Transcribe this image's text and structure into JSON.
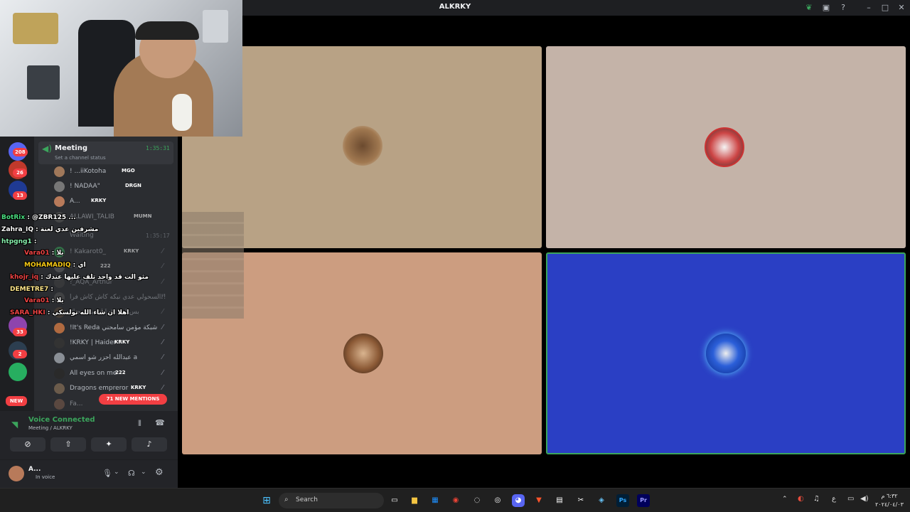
{
  "window": {
    "title": "ALKRKY"
  },
  "titlebar_icons": [
    "leaf-icon",
    "inbox-icon",
    "help-icon",
    "minimize-icon",
    "maximize-icon",
    "close-icon"
  ],
  "stage": {
    "tiles": [
      {
        "name": "tile-participant-1",
        "bg": "#b8a285"
      },
      {
        "name": "tile-participant-2",
        "bg": "#c4b3a8"
      },
      {
        "name": "tile-participant-3",
        "bg": "#cc9d80"
      },
      {
        "name": "tile-participant-4",
        "bg": "#2a3fc4",
        "speaking": true
      }
    ]
  },
  "servers": {
    "badges": [
      "208",
      "26",
      "13",
      "33",
      "2"
    ],
    "new_label": "NEW"
  },
  "channel": {
    "meeting_name": "Meeting",
    "meeting_time": "1:35:31",
    "status_placeholder": "Set a channel status",
    "meeting_users": [
      {
        "name": "! ...iiKotoha",
        "tag": "MGO"
      },
      {
        "name": "! NADAA\"",
        "tag": "DRGN"
      },
      {
        "name": "A...",
        "tag": "KRKY"
      },
      {
        "name": "ALLAWI_TALIB",
        "tag": "MUMN"
      }
    ],
    "waiting_name": "Waiting",
    "waiting_time": "1:35:17",
    "waiting_users": [
      {
        "name": "! Kakarot0_",
        "tag": "KRKY"
      },
      {
        "name": "! ...",
        "tag": "222"
      },
      {
        "name": "!_AQA_Arthur",
        "tag": ""
      },
      {
        "name": "السحولي عدي نبكه كاش كاش فرا!!",
        "tag": ""
      },
      {
        "name": "بس اريد اقرا اشتيه سحنك",
        "tag": ""
      },
      {
        "name": "!It's Reda شبكة مؤمن سامحني",
        "tag": ""
      },
      {
        "name": "!KRKY | Haider",
        "tag": "KRKY"
      },
      {
        "name": "عبدالله احزر شو اسمي a",
        "tag": ""
      },
      {
        "name": "All eyes on me",
        "tag": "222"
      },
      {
        "name": "Dragons empreror",
        "tag": "KRKY"
      },
      {
        "name": "Fa...",
        "tag": ""
      }
    ],
    "mentions_label": "71 NEW MENTIONS"
  },
  "chat_overlay": [
    {
      "user": "BotRix",
      "text": ": @ZBR125 ...",
      "color": "#4ade80"
    },
    {
      "user": "Zahra_IQ",
      "text": ": مشرفين عدي لعنة",
      "color": "#ffffff"
    },
    {
      "user": "htpgng1",
      "text": ":",
      "color": "#86efac"
    },
    {
      "user": "Vara01",
      "text": ": بلا",
      "color": "#ef4444"
    },
    {
      "user": "MOHAMADIQ",
      "text": ": اي",
      "color": "#facc15"
    },
    {
      "user": "khojr_iq",
      "text": ": مثو الت قد واحد تلف عليها عندك",
      "color": "#ef4444"
    },
    {
      "user": "DEMETRE7",
      "text": ":",
      "color": "#fde68a"
    },
    {
      "user": "Vara01",
      "text": ": بلا",
      "color": "#ef4444"
    },
    {
      "user": "SARA_HKI",
      "text": ": اهلا ان شاء الله تولسكي",
      "color": "#ef4444"
    }
  ],
  "voice": {
    "status": "Voice Connected",
    "location": "Meeting / ALKRKY",
    "buttons": [
      "camera-off-icon",
      "screen-share-icon",
      "activities-icon",
      "soundboard-icon"
    ]
  },
  "user_panel": {
    "name": "A...",
    "status": "In voice"
  },
  "taskbar": {
    "search_label": "Search",
    "clock_time": "٦:٣٢ م",
    "clock_date": "٢٠٢٤/٠٤/٠٣",
    "lang": "ع"
  }
}
